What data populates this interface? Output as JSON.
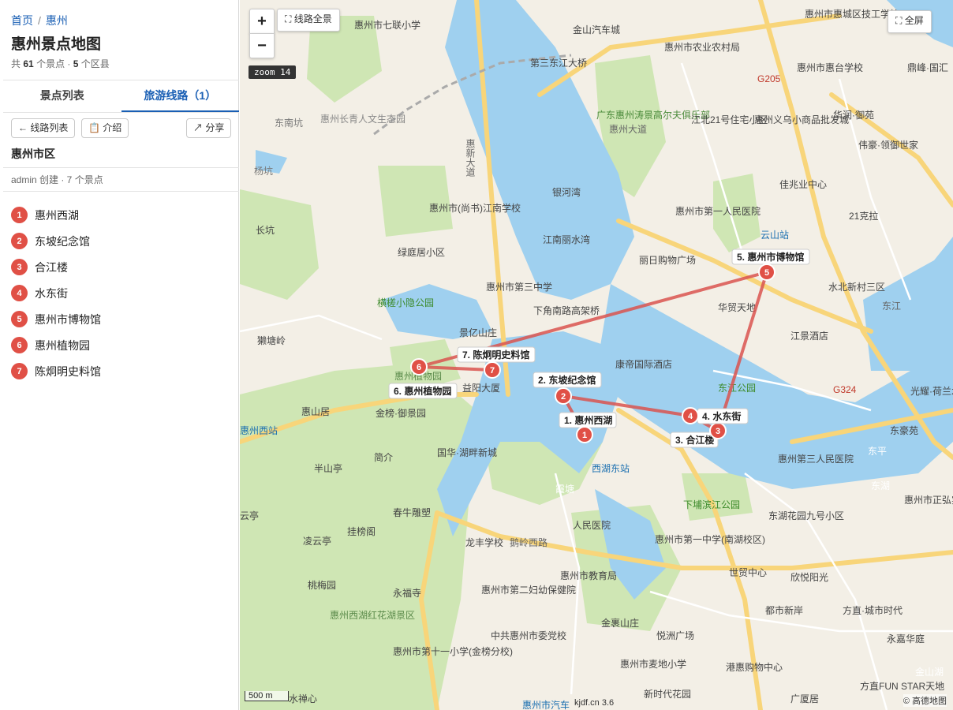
{
  "breadcrumb": {
    "home": "首页",
    "sep": "/",
    "current": "惠州"
  },
  "page_title": "惠州景点地图",
  "stats": {
    "prefix": "共",
    "spots": "61",
    "spots_unit": "个景点 ·",
    "districts": "5",
    "districts_unit": "个区县"
  },
  "tabs": [
    {
      "label": "景点列表"
    },
    {
      "label": "旅游线路（1）"
    }
  ],
  "toolbar": {
    "back_label": "← 线路列表",
    "intro_label": "📋 介绍",
    "share_label": "↗ 分享"
  },
  "route": {
    "name": "惠州市区",
    "meta": "admin 创建 · 7 个景点",
    "stops": [
      {
        "num": "1",
        "name": "惠州西湖"
      },
      {
        "num": "2",
        "name": "东坡纪念馆"
      },
      {
        "num": "3",
        "name": "合江楼"
      },
      {
        "num": "4",
        "name": "水东街"
      },
      {
        "num": "5",
        "name": "惠州市博物馆"
      },
      {
        "num": "6",
        "name": "惠州植物园"
      },
      {
        "num": "7",
        "name": "陈炯明史料馆"
      }
    ]
  },
  "map": {
    "zoom_in": "+",
    "zoom_out": "−",
    "overview_label": "⛶ 线路全景",
    "fullscreen_label": "⛶ 全屏",
    "zoom_tag": "zoom 14",
    "scale_label": "500 m",
    "attribution": "© 高德地图",
    "credit": "kjdf.cn 3.6",
    "markers": [
      {
        "num": "1",
        "label": "1. 惠州西湖"
      },
      {
        "num": "2",
        "label": "2. 东坡纪念馆"
      },
      {
        "num": "3",
        "label": "3. 合江楼"
      },
      {
        "num": "4",
        "label": "4. 水东街"
      },
      {
        "num": "5",
        "label": "5. 惠州市博物馆"
      },
      {
        "num": "6",
        "label": "6. 惠州植物园"
      },
      {
        "num": "7",
        "label": "7. 陈炯明史料馆"
      }
    ],
    "places": [
      "惠州市七联小学",
      "金山汽车城",
      "第三东江大桥",
      "惠州市农业农村局",
      "惠州市惠城区技工学校",
      "惠州市惠台学校",
      "鼎峰·国汇",
      "惠州长青人文生态园",
      "东南坑",
      "广东惠州涛景高尔夫俱乐部",
      "江北21号住宅小区",
      "惠州义乌小商品批发城",
      "华润·御苑",
      "伟豪·领御世家",
      "杨坑",
      "惠州市(尚书)江南学校",
      "银河湾",
      "佳兆业中心",
      "21克拉",
      "长坑",
      "惠州市第一人民医院",
      "云山站",
      "绿庭居小区",
      "江南丽水湾",
      "丽日购物广场",
      "惠州市第三中学",
      "横槎小隐公园",
      "下角南路高架桥",
      "华贸天地",
      "水北新村三区",
      "獭塘岭",
      "景亿山庄",
      "江景酒店",
      "康帝国际酒店",
      "惠州植物园",
      "益阳大厦",
      "东江公园",
      "光耀·荷兰水乡花语岸",
      "惠山居",
      "金榜·御景园",
      "惠州西站",
      "国华·湖畔新城",
      "西湖东站",
      "东豪苑",
      "惠州第三人民医院",
      "东平",
      "半山亭",
      "简介",
      "东湖",
      "下埔滨江公园",
      "惠州市正弘实验学校",
      "云亭",
      "春牛雕塑",
      "霞塘",
      "人民医院",
      "东湖花园九号小区",
      "凌云亭",
      "挂榜阁",
      "龙丰学校",
      "鹅岭西路",
      "惠州市第一中学(南湖校区)",
      "世贸中心",
      "欣悦阳光",
      "桃梅园",
      "永福寺",
      "惠州市第二妇幼保健院",
      "惠州市教育局",
      "都市新岸",
      "方直·城市时代",
      "惠州西湖红花湖景区",
      "金裹山庄",
      "悦洲广场",
      "永嘉华庭",
      "中共惠州市委党校",
      "惠州市第十一小学(金榜分校)",
      "惠州市麦地小学",
      "港惠购物中心",
      "方直FUN STAR天地",
      "金山湖",
      "水禅心",
      "新时代花园",
      "惠州市汽车",
      "广厦居",
      "惠新大道",
      "惠州大道",
      "东江",
      "G205",
      "G324"
    ]
  }
}
